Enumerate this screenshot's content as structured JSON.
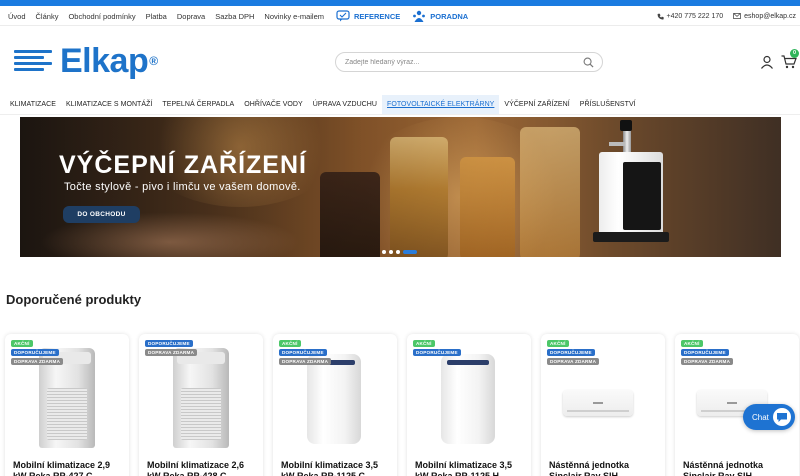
{
  "topbar": {
    "links": [
      "Úvod",
      "Články",
      "Obchodní podmínky",
      "Platba",
      "Doprava",
      "Sazba DPH",
      "Novinky e-mailem"
    ],
    "reference_label": "REFERENCE",
    "poradna_label": "PORADNA",
    "phone": "+420 775 222 170",
    "email": "eshop@elkap.cz"
  },
  "header": {
    "logo_text": "Elkap",
    "logo_reg": "®",
    "search_placeholder": "Zadejte hledaný výraz...",
    "cart_count": "0"
  },
  "nav": {
    "items": [
      "KLIMATIZACE",
      "KLIMATIZACE S MONTÁŽÍ",
      "TEPELNÁ ČERPADLA",
      "OHŘÍVAČE VODY",
      "ÚPRAVA VZDUCHU",
      "FOTOVOLTAICKÉ ELEKTRÁRNY",
      "VÝČEPNÍ ZAŘÍZENÍ",
      "PŘÍSLUŠENSTVÍ"
    ],
    "active_index": 5
  },
  "hero": {
    "title": "VÝČEPNÍ ZAŘÍZENÍ",
    "subtitle": "Točte stylově - pivo i limču ve vašem domově.",
    "button_label": "DO OBCHODU",
    "slide_count": 4,
    "active_slide": 3
  },
  "products_section": {
    "title": "Doporučené produkty",
    "items": [
      {
        "badges": [
          "AKČNÍ",
          "DOPORUČUJEME",
          "DOPRAVA ZDARMA"
        ],
        "name": "Mobilní klimatizace 2,9 kW Reka RP-427 C",
        "kind": "portable-grey"
      },
      {
        "badges": [
          "DOPORUČUJEME",
          "DOPRAVA ZDARMA"
        ],
        "name": "Mobilní klimatizace 2,6 kW Reka RP-428 C",
        "kind": "portable-grey"
      },
      {
        "badges": [
          "AKČNÍ",
          "DOPORUČUJEME",
          "DOPRAVA ZDARMA"
        ],
        "name": "Mobilní klimatizace 3,5 kW Reka RP-1125 C",
        "kind": "portable-white"
      },
      {
        "badges": [
          "AKČNÍ",
          "DOPORUČUJEME"
        ],
        "name": "Mobilní klimatizace 3,5 kW Reka RP-1125 H",
        "kind": "portable-white"
      },
      {
        "badges": [
          "AKČNÍ",
          "DOPORUČUJEME",
          "DOPRAVA ZDARMA"
        ],
        "name": "Nástěnná jednotka Sinclair Ray SIH",
        "kind": "wall"
      },
      {
        "badges": [
          "AKČNÍ",
          "DOPORUČUJEME",
          "DOPRAVA ZDARMA"
        ],
        "name": "Nástěnná jednotka Sinclair Ray SIH",
        "kind": "wall"
      }
    ]
  },
  "chat": {
    "label": "Chat"
  }
}
